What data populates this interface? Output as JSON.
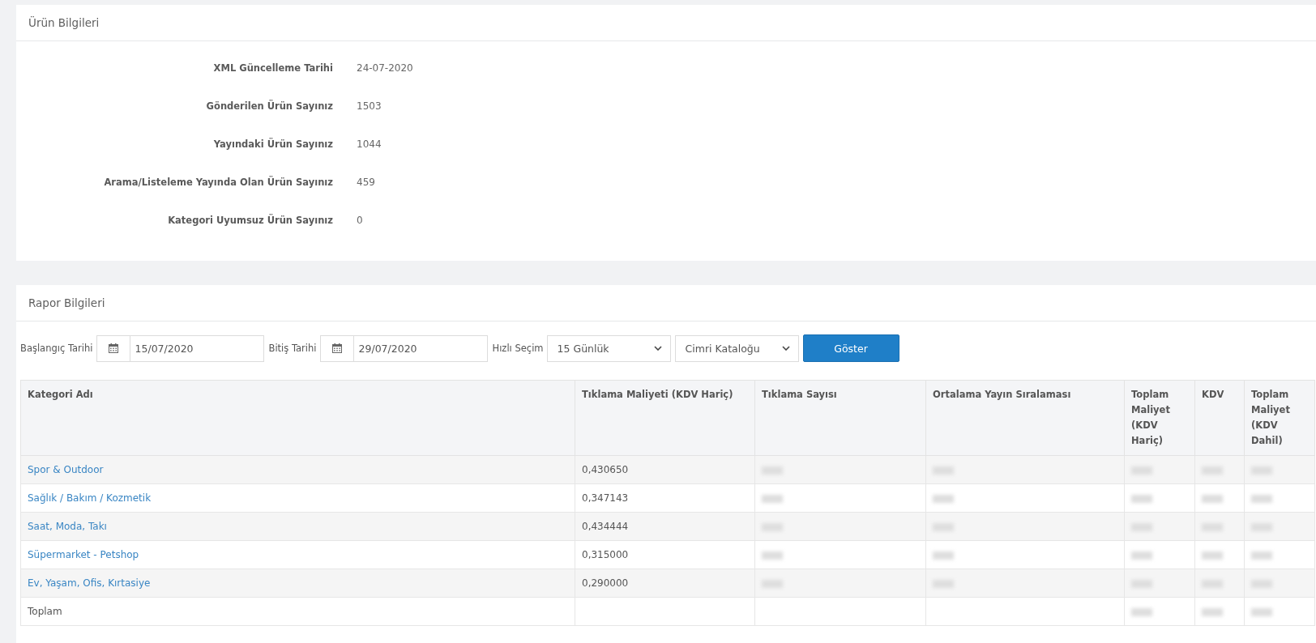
{
  "product_info": {
    "title": "Ürün Bilgileri",
    "fields": [
      {
        "label": "XML Güncelleme Tarihi",
        "value": "24-07-2020"
      },
      {
        "label": "Gönderilen Ürün Sayınız",
        "value": "1503"
      },
      {
        "label": "Yayındaki Ürün Sayınız",
        "value": "1044"
      },
      {
        "label": "Arama/Listeleme Yayında Olan Ürün Sayınız",
        "value": "459"
      },
      {
        "label": "Kategori Uyumsuz Ürün Sayınız",
        "value": "0"
      }
    ]
  },
  "report_info": {
    "title": "Rapor Bilgileri",
    "filters": [
      {
        "kind": "date",
        "label": "Başlangıç Tarihi",
        "value": "15/07/2020"
      },
      {
        "kind": "date",
        "label": "Bitiş Tarihi",
        "value": "29/07/2020"
      },
      {
        "kind": "select",
        "label": "Hızlı Seçim",
        "value": "15 Günlük"
      },
      {
        "kind": "select",
        "value": "Cimri Kataloğu"
      },
      {
        "kind": "button",
        "label": "Göster"
      }
    ],
    "table": {
      "columns": [
        "Kategori Adı",
        "Tıklama Maliyeti (KDV Hariç)",
        "Tıklama Sayısı",
        "Ortalama Yayın Sıralaması",
        "Toplam Maliyet (KDV Hariç)",
        "KDV",
        "Toplam Maliyet (KDV Dahil)"
      ],
      "rows": [
        {
          "cells": [
            {
              "kind": "link",
              "text": "Spor & Outdoor"
            },
            {
              "kind": "text",
              "text": "0,430650"
            },
            {
              "kind": "blurred"
            },
            {
              "kind": "blurred"
            },
            {
              "kind": "blurred"
            },
            {
              "kind": "blurred"
            },
            {
              "kind": "blurred"
            }
          ]
        },
        {
          "cells": [
            {
              "kind": "link",
              "text": "Sağlık / Bakım / Kozmetik"
            },
            {
              "kind": "text",
              "text": "0,347143"
            },
            {
              "kind": "blurred"
            },
            {
              "kind": "blurred"
            },
            {
              "kind": "blurred"
            },
            {
              "kind": "blurred"
            },
            {
              "kind": "blurred"
            }
          ]
        },
        {
          "cells": [
            {
              "kind": "link",
              "text": "Saat, Moda, Takı"
            },
            {
              "kind": "text",
              "text": "0,434444"
            },
            {
              "kind": "blurred"
            },
            {
              "kind": "blurred"
            },
            {
              "kind": "blurred"
            },
            {
              "kind": "blurred"
            },
            {
              "kind": "blurred"
            }
          ]
        },
        {
          "cells": [
            {
              "kind": "link",
              "text": "Süpermarket - Petshop"
            },
            {
              "kind": "text",
              "text": "0,315000"
            },
            {
              "kind": "blurred"
            },
            {
              "kind": "blurred"
            },
            {
              "kind": "blurred"
            },
            {
              "kind": "blurred"
            },
            {
              "kind": "blurred"
            }
          ]
        },
        {
          "cells": [
            {
              "kind": "link",
              "text": "Ev, Yaşam, Ofis, Kırtasiye"
            },
            {
              "kind": "text",
              "text": "0,290000"
            },
            {
              "kind": "blurred"
            },
            {
              "kind": "blurred"
            },
            {
              "kind": "blurred"
            },
            {
              "kind": "blurred"
            },
            {
              "kind": "blurred"
            }
          ]
        },
        {
          "cells": [
            {
              "kind": "text",
              "text": "Toplam"
            },
            {
              "kind": "empty"
            },
            {
              "kind": "empty"
            },
            {
              "kind": "empty"
            },
            {
              "kind": "blurred"
            },
            {
              "kind": "blurred"
            },
            {
              "kind": "blurred"
            }
          ]
        }
      ]
    }
  }
}
